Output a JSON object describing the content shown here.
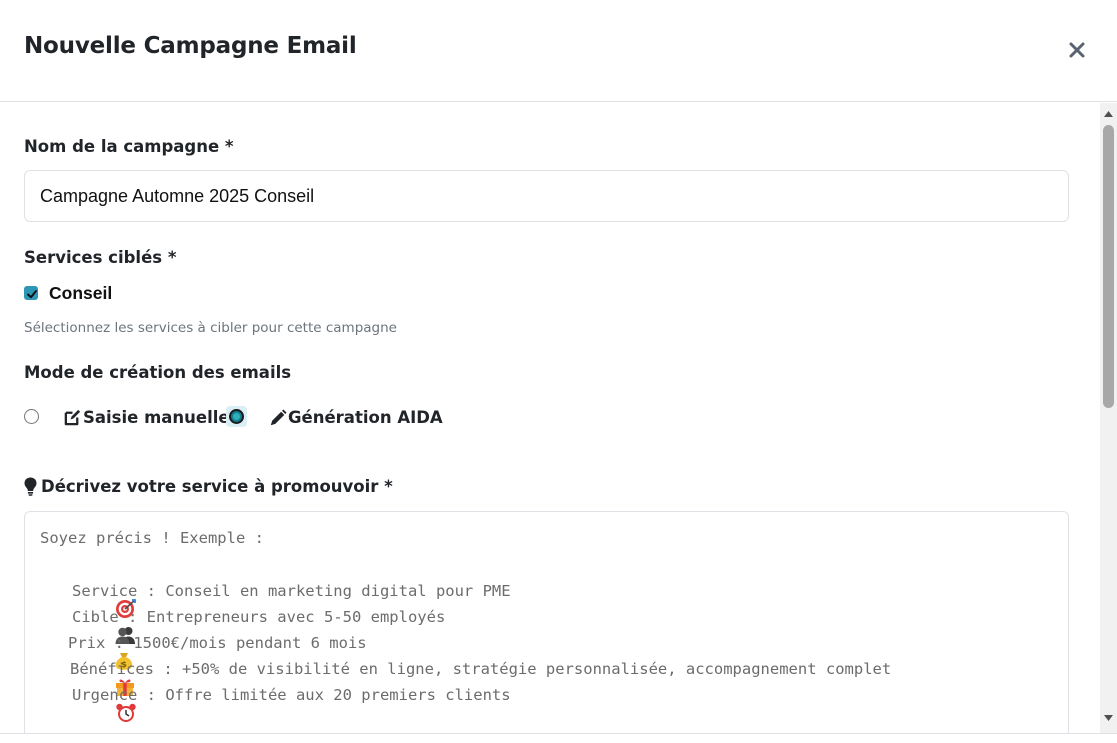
{
  "modal": {
    "title": "Nouvelle Campagne Email",
    "close_icon": "close-icon"
  },
  "campaign_name": {
    "label": "Nom de la campagne *",
    "value": "Campagne Automne 2025 Conseil"
  },
  "services": {
    "label": "Services ciblés *",
    "items": [
      {
        "label": "Conseil",
        "checked": true
      }
    ],
    "help": "Sélectionnez les services à cibler pour cette campagne"
  },
  "creation_mode": {
    "label": "Mode de création des emails",
    "options": [
      {
        "label": "Saisie manuelle",
        "icon": "edit-icon",
        "selected": false
      },
      {
        "label": "Génération AIDA",
        "icon": "pencil-icon",
        "selected": true
      }
    ]
  },
  "description": {
    "label": "Décrivez votre service à promouvoir *",
    "icon": "lightbulb-icon",
    "placeholder_intro": "Soyez précis ! Exemple :",
    "placeholder_lines": [
      {
        "icon": "target-emoji",
        "text": "Service : Conseil en marketing digital pour PME"
      },
      {
        "icon": "people-emoji",
        "text": "Cible : Entrepreneurs avec 5-50 employés"
      },
      {
        "icon": "money-bag-emoji",
        "text": "Prix : 1500€/mois pendant 6 mois"
      },
      {
        "icon": "gift-emoji",
        "text": "Bénéfices : +50% de visibilité en ligne, stratégie personnalisée, accompagnement complet"
      },
      {
        "icon": "alarm-clock-emoji",
        "text": "Urgence : Offre limitée aux 20 premiers clients"
      }
    ]
  },
  "colors": {
    "accent": "#2f97b5",
    "border": "#dee2e6",
    "muted_text": "#6c757d"
  }
}
